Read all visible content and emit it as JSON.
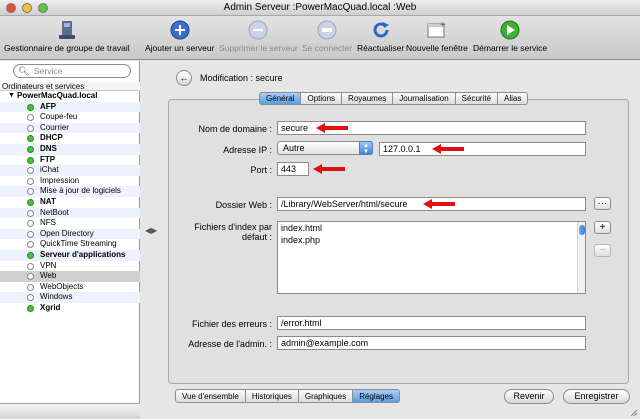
{
  "window": {
    "title": "Admin Serveur :PowerMacQuad.local :Web"
  },
  "toolbar": {
    "items": [
      {
        "label": "Gestionnaire de groupe de travail",
        "icon": "workgroup-manager-icon"
      },
      {
        "label": "Ajouter un serveur",
        "icon": "add-icon"
      },
      {
        "label": "Supprimer le serveur",
        "icon": "remove-icon"
      },
      {
        "label": "Se connecter",
        "icon": "connect-icon"
      },
      {
        "label": "Réactualiser",
        "icon": "refresh-icon"
      },
      {
        "label": "Nouvelle fenêtre",
        "icon": "new-window-icon"
      },
      {
        "label": "Démarrer le service",
        "icon": "play-icon"
      }
    ]
  },
  "sidebar": {
    "search_placeholder": "Service",
    "header": "Ordinateurs et services",
    "host": "PowerMacQuad.local",
    "services": [
      {
        "name": "AFP",
        "running": true
      },
      {
        "name": "Coupe-feu",
        "running": false
      },
      {
        "name": "Courrier",
        "running": false
      },
      {
        "name": "DHCP",
        "running": true
      },
      {
        "name": "DNS",
        "running": true
      },
      {
        "name": "FTP",
        "running": true
      },
      {
        "name": "iChat",
        "running": false
      },
      {
        "name": "Impression",
        "running": false
      },
      {
        "name": "Mise à jour de logiciels",
        "running": false
      },
      {
        "name": "NAT",
        "running": true
      },
      {
        "name": "NetBoot",
        "running": false
      },
      {
        "name": "NFS",
        "running": false
      },
      {
        "name": "Open Directory",
        "running": false
      },
      {
        "name": "QuickTime Streaming",
        "running": false
      },
      {
        "name": "Serveur d'applications",
        "running": true
      },
      {
        "name": "VPN",
        "running": false
      },
      {
        "name": "Web",
        "running": false,
        "selected": true
      },
      {
        "name": "WebObjects",
        "running": false
      },
      {
        "name": "Windows",
        "running": false
      },
      {
        "name": "Xgrid",
        "running": true
      }
    ]
  },
  "main": {
    "header": "Modification : secure",
    "tabs": [
      "Général",
      "Options",
      "Royaumes",
      "Journalisation",
      "Sécurité",
      "Alias"
    ],
    "active_tab": "Général",
    "form": {
      "domain_label": "Nom de domaine :",
      "domain_value": "secure",
      "ip_label": "Adresse IP :",
      "ip_popup": "Autre",
      "ip_value": "127.0.0.1",
      "port_label": "Port :",
      "port_value": "443",
      "folder_label": "Dossier Web :",
      "folder_value": "/Library/WebServer/html/secure",
      "folder_button": "···",
      "index_label_1": "Fichiers d'index par",
      "index_label_2": "défaut :",
      "index_files": [
        "index.html",
        "index.php"
      ],
      "add_button": "+",
      "remove_button": "−",
      "errors_label": "Fichier des erreurs :",
      "errors_value": "/error.html",
      "admin_label": "Adresse de l'admin. :",
      "admin_value": "admin@example.com"
    },
    "bottom_tabs": [
      "Vue d'ensemble",
      "Historiques",
      "Graphiques",
      "Réglages"
    ],
    "active_bottom_tab": "Réglages",
    "revert_button": "Revenir",
    "save_button": "Enregistrer"
  },
  "colors": {
    "accent": "#5b9de6",
    "running": "#49c23a",
    "arrow": "#e01010"
  }
}
